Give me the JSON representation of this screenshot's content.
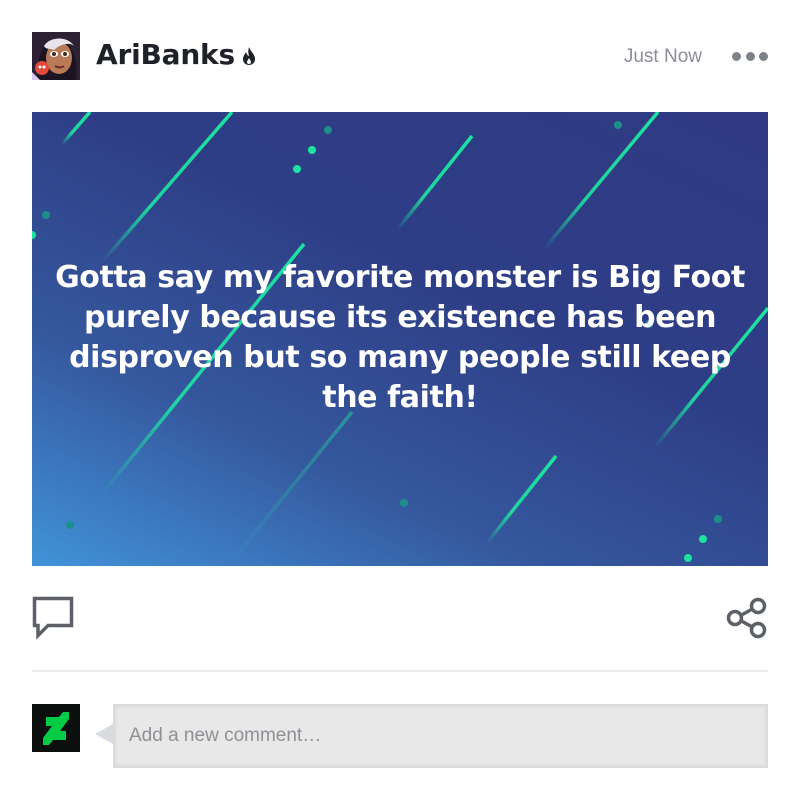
{
  "post": {
    "username": "AriBanks",
    "timestamp": "Just Now",
    "body_text": "Gotta say my favorite monster is Big Foot purely because its existence has been disproven but so many people still keep the faith!"
  },
  "comments": {
    "placeholder": "Add a new comment…"
  },
  "colors": {
    "accent_green": "#05cc47",
    "card_gradient_start": "#4193d9",
    "card_gradient_end": "#2f3a82",
    "streak_color": "#1de3a0"
  },
  "icons": {
    "more": "more-horizontal-icon",
    "comment": "speech-bubble-icon",
    "share": "share-nodes-icon",
    "badge": "flame-icon",
    "brand": "deviantart-logo-icon"
  }
}
